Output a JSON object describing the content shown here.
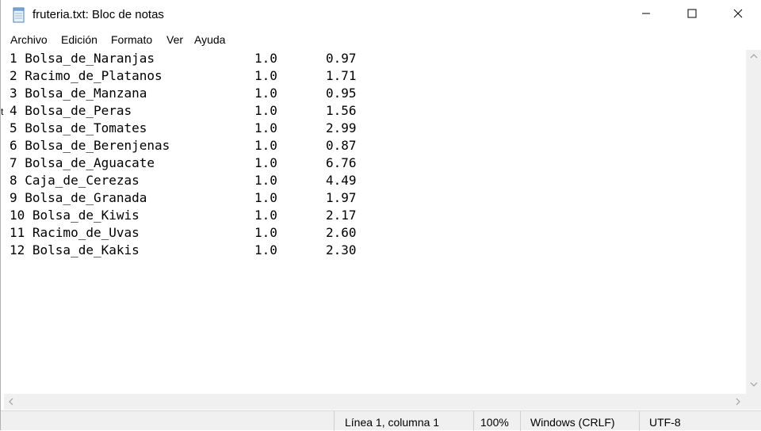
{
  "window": {
    "title": "fruteria.txt: Bloc de notas"
  },
  "menu": [
    "Archivo",
    "Edición",
    "Formato",
    "Ver",
    "Ayuda"
  ],
  "editor_lines": [
    {
      "name": "1 Bolsa_de_Naranjas",
      "qty": "1.0",
      "price": "0.97"
    },
    {
      "name": "2 Racimo_de_Platanos",
      "qty": "1.0",
      "price": "1.71"
    },
    {
      "name": "3 Bolsa_de_Manzana",
      "qty": "1.0",
      "price": "0.95"
    },
    {
      "name": "4 Bolsa_de_Peras",
      "qty": "1.0",
      "price": "1.56"
    },
    {
      "name": "5 Bolsa_de_Tomates",
      "qty": "1.0",
      "price": "2.99"
    },
    {
      "name": "6 Bolsa_de_Berenjenas",
      "qty": "1.0",
      "price": "0.87"
    },
    {
      "name": "7 Bolsa_de_Aguacate",
      "qty": "1.0",
      "price": "6.76"
    },
    {
      "name": "8 Caja_de_Cerezas",
      "qty": "1.0",
      "price": "4.49"
    },
    {
      "name": "9 Bolsa_de_Granada",
      "qty": "1.0",
      "price": "1.97"
    },
    {
      "name": "10 Bolsa_de_Kiwis",
      "qty": "1.0",
      "price": "2.17"
    },
    {
      "name": "11 Racimo_de_Uvas",
      "qty": "1.0",
      "price": "2.60"
    },
    {
      "name": "12 Bolsa_de_Kakis",
      "qty": "1.0",
      "price": "2.30"
    }
  ],
  "status": {
    "position": "Línea 1, columna 1",
    "zoom": "100%",
    "line_endings": "Windows (CRLF)",
    "encoding": "UTF-8"
  },
  "edge_glyph": "t",
  "icons": {
    "app": "notepad-icon",
    "minimize": "minimize-icon",
    "maximize": "maximize-icon",
    "close": "close-icon"
  }
}
